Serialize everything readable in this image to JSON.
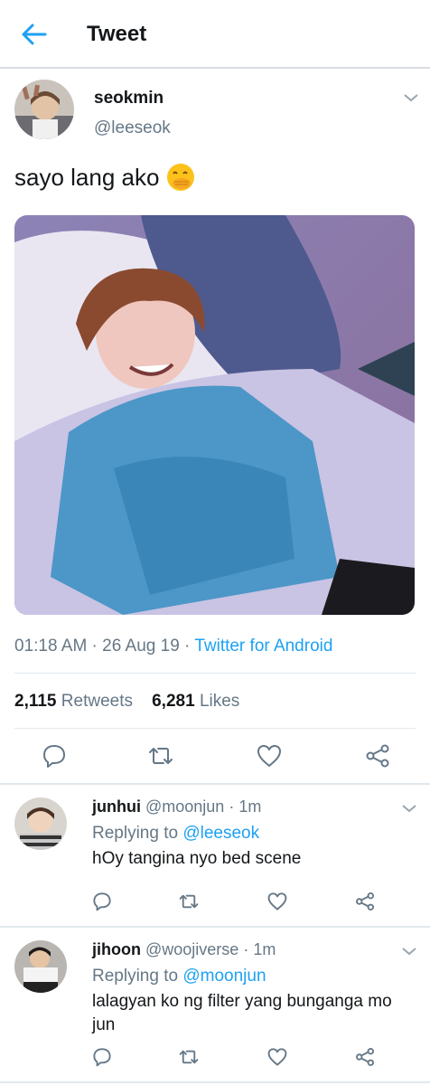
{
  "header": {
    "title": "Tweet"
  },
  "main_tweet": {
    "name": "seokmin",
    "handle": "@leeseok",
    "text": "sayo lang ako",
    "time": "01:18 AM",
    "date": "26 Aug 19",
    "source": "Twitter for Android",
    "retweets_count": "2,115",
    "retweets_label": "Retweets",
    "likes_count": "6,281",
    "likes_label": "Likes"
  },
  "replies": [
    {
      "name": "junhui",
      "handle": "@moonjun",
      "time": "1m",
      "replying_prefix": "Replying to",
      "replying_to": "@leeseok",
      "text": "hOy tangina nyo bed scene"
    },
    {
      "name": "jihoon",
      "handle": "@woojiverse",
      "time": "1m",
      "replying_prefix": "Replying to",
      "replying_to": "@moonjun",
      "text": "lalagyan ko ng filter yang bunganga mo jun"
    }
  ],
  "colors": {
    "accent": "#1da1f2",
    "muted": "#657786",
    "text": "#14171a",
    "divider": "#e1e8ed"
  },
  "icons": [
    "back-arrow-icon",
    "chevron-down-icon",
    "reply-icon",
    "retweet-icon",
    "like-icon",
    "share-icon",
    "hand-over-mouth-emoji-icon"
  ]
}
